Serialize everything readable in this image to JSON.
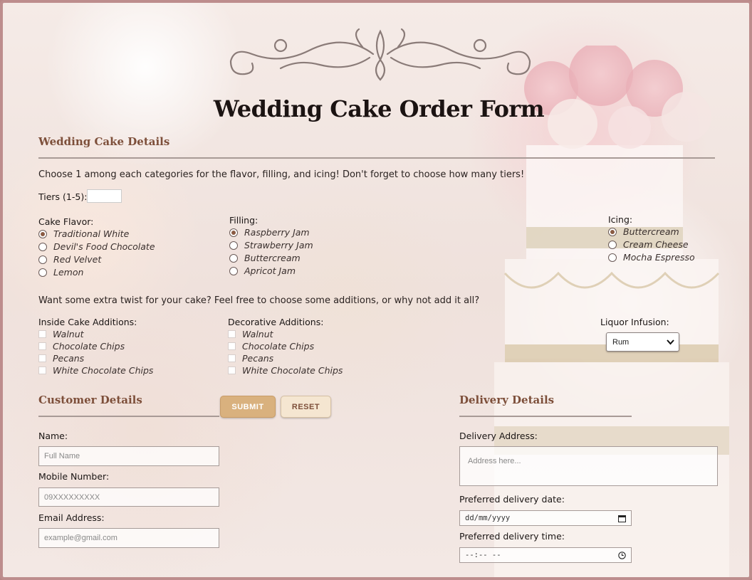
{
  "page": {
    "title": "Wedding Cake Order Form"
  },
  "cake_details": {
    "section_title": "Wedding Cake Details",
    "instructions": "Choose 1 among each categories for the flavor, filling, and icing! Don't forget to choose how many tiers!",
    "tiers_label": "Tiers (1-5):",
    "tiers_value": "",
    "flavor": {
      "label": "Cake Flavor:",
      "selected": "Traditional White",
      "options": [
        "Traditional White",
        "Devil's Food Chocolate",
        "Red Velvet",
        "Lemon"
      ]
    },
    "filling": {
      "label": "Filling:",
      "selected": "Raspberry Jam",
      "options": [
        "Raspberry Jam",
        "Strawberry Jam",
        "Buttercream",
        "Apricot Jam"
      ]
    },
    "icing": {
      "label": "Icing:",
      "selected": "Buttercream",
      "options": [
        "Buttercream",
        "Cream Cheese",
        "Mocha Espresso"
      ]
    },
    "additions_prompt": "Want some extra twist for your cake? Feel free to choose some additions, or why not add it all?",
    "inside_additions": {
      "label": "Inside Cake Additions:",
      "options": [
        "Walnut",
        "Chocolate Chips",
        "Pecans",
        "White Chocolate Chips"
      ]
    },
    "decorative_additions": {
      "label": "Decorative Additions:",
      "options": [
        "Walnut",
        "Chocolate Chips",
        "Pecans",
        "White Chocolate Chips"
      ]
    },
    "liquor": {
      "label": "Liquor Infusion:",
      "selected": "Rum"
    }
  },
  "buttons": {
    "submit": "SUBMIT",
    "reset": "RESET"
  },
  "customer": {
    "section_title": "Customer Details",
    "name_label": "Name:",
    "name_placeholder": "Full Name",
    "mobile_label": "Mobile Number:",
    "mobile_placeholder": "09XXXXXXXXX",
    "email_label": "Email Address:",
    "email_placeholder": "example@gmail.com"
  },
  "delivery": {
    "section_title": "Delivery Details",
    "address_label": "Delivery Address:",
    "address_placeholder": "Address here...",
    "date_label": "Preferred delivery date:",
    "date_placeholder": "dd/mm/yyyy",
    "time_label": "Preferred delivery time:",
    "time_placeholder": "--:-- --"
  },
  "colors": {
    "accent": "#7d4f3a",
    "submit_bg": "#d9b17e",
    "reset_bg": "#f5e6d1",
    "border": "#bd8d8d"
  }
}
